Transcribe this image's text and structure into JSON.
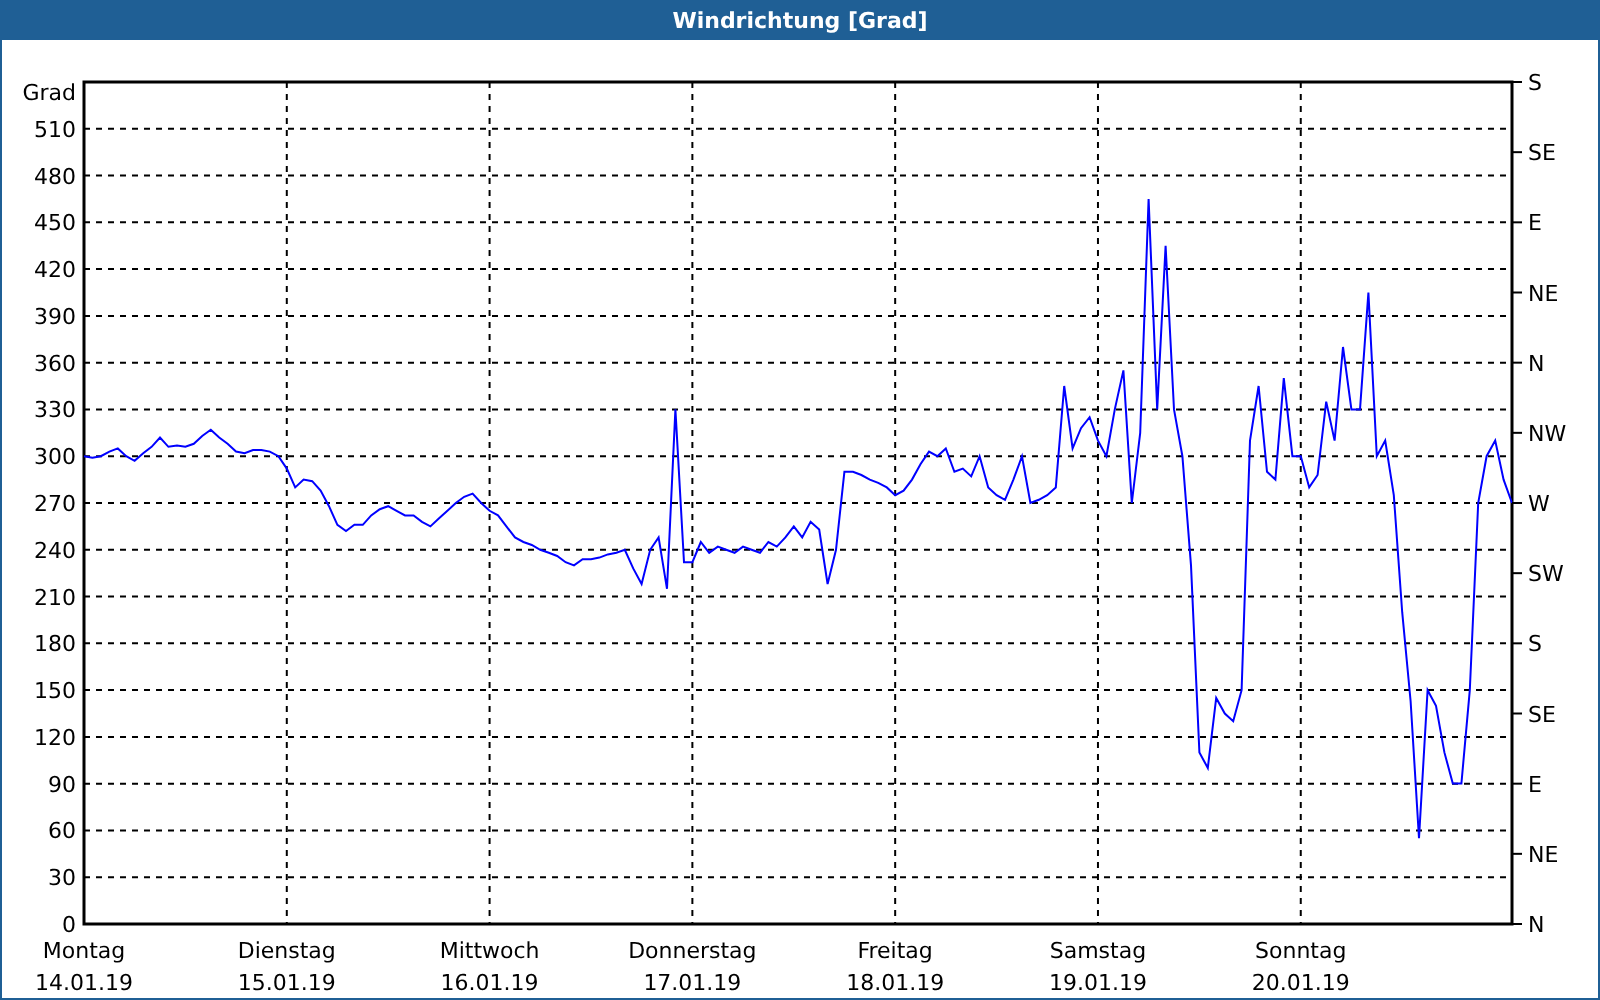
{
  "window": {
    "title": "Windrichtung [Grad]"
  },
  "chart": {
    "right_axis": [
      "S",
      "SE",
      "E",
      "NE",
      "N",
      "NW",
      "W",
      "SW",
      "S",
      "SE",
      "E",
      "NE",
      "N"
    ],
    "chart_data": {
      "type": "line",
      "ylabel": "Grad",
      "grid": true,
      "ylim": [
        0,
        540
      ],
      "categories": [
        "Montag 14.01.19",
        null,
        null,
        null,
        null,
        null,
        null,
        null,
        null,
        null,
        null,
        null,
        null,
        null,
        null,
        null,
        null,
        null,
        null,
        null,
        null,
        null,
        null,
        null,
        "Dienstag 15.01.19",
        null,
        null,
        null,
        null,
        null,
        null,
        null,
        null,
        null,
        null,
        null,
        null,
        null,
        null,
        null,
        null,
        null,
        null,
        null,
        null,
        null,
        null,
        null,
        "Mittwoch 16.01.19",
        null,
        null,
        null,
        null,
        null,
        null,
        null,
        null,
        null,
        null,
        null,
        null,
        null,
        null,
        null,
        null,
        null,
        null,
        null,
        null,
        null,
        null,
        null,
        "Donnerstag 17.01.19",
        null,
        null,
        null,
        null,
        null,
        null,
        null,
        null,
        null,
        null,
        null,
        null,
        null,
        null,
        null,
        null,
        null,
        null,
        null,
        null,
        null,
        null,
        null,
        "Freitag 18.01.19",
        null,
        null,
        null,
        null,
        null,
        null,
        null,
        null,
        null,
        null,
        null,
        null,
        null,
        null,
        null,
        null,
        null,
        null,
        null,
        null,
        null,
        null,
        null,
        "Samstag 19.01.19",
        null,
        null,
        null,
        null,
        null,
        null,
        null,
        null,
        null,
        null,
        null,
        null,
        null,
        null,
        null,
        null,
        null,
        null,
        null,
        null,
        null,
        null,
        null,
        "Sonntag 20.01.19",
        null,
        null,
        null,
        null,
        null,
        null,
        null,
        null,
        null,
        null,
        null,
        null,
        null,
        null,
        null,
        null,
        null,
        null,
        null,
        null,
        null,
        null,
        null,
        null,
        null
      ],
      "yticks": [
        0,
        30,
        60,
        90,
        120,
        150,
        180,
        210,
        240,
        270,
        300,
        330,
        360,
        390,
        420,
        450,
        480,
        510
      ],
      "series": [
        {
          "color": "#0000ff",
          "values": [
            300,
            299,
            300,
            303,
            305,
            300,
            297,
            302,
            306,
            312,
            306,
            307,
            306,
            308,
            313,
            317,
            312,
            308,
            303,
            302,
            304,
            304,
            303,
            300,
            292,
            280,
            285,
            284,
            278,
            268,
            256,
            252,
            256,
            256,
            262,
            266,
            268,
            265,
            262,
            262,
            258,
            255,
            260,
            265,
            270,
            274,
            276,
            270,
            265,
            262,
            255,
            248,
            245,
            243,
            240,
            238,
            236,
            232,
            230,
            234,
            234,
            235,
            237,
            238,
            240,
            228,
            218,
            240,
            248,
            215,
            330,
            232,
            232,
            245,
            238,
            242,
            240,
            238,
            242,
            240,
            238,
            245,
            242,
            248,
            255,
            248,
            258,
            253,
            218,
            240,
            290,
            290,
            288,
            285,
            283,
            280,
            275,
            278,
            285,
            295,
            303,
            300,
            305,
            290,
            292,
            287,
            300,
            280,
            275,
            272,
            285,
            300,
            270,
            272,
            275,
            280,
            345,
            305,
            318,
            325,
            310,
            300,
            330,
            355,
            270,
            315,
            465,
            330,
            435,
            330,
            300,
            230,
            110,
            100,
            145,
            135,
            130,
            150,
            310,
            345,
            290,
            285,
            350,
            300,
            300,
            280,
            288,
            335,
            310,
            370,
            330,
            330,
            405,
            300,
            310,
            275,
            200,
            143,
            55,
            150,
            140,
            110,
            90,
            90,
            150,
            270,
            300,
            310,
            285,
            270
          ]
        }
      ]
    }
  }
}
